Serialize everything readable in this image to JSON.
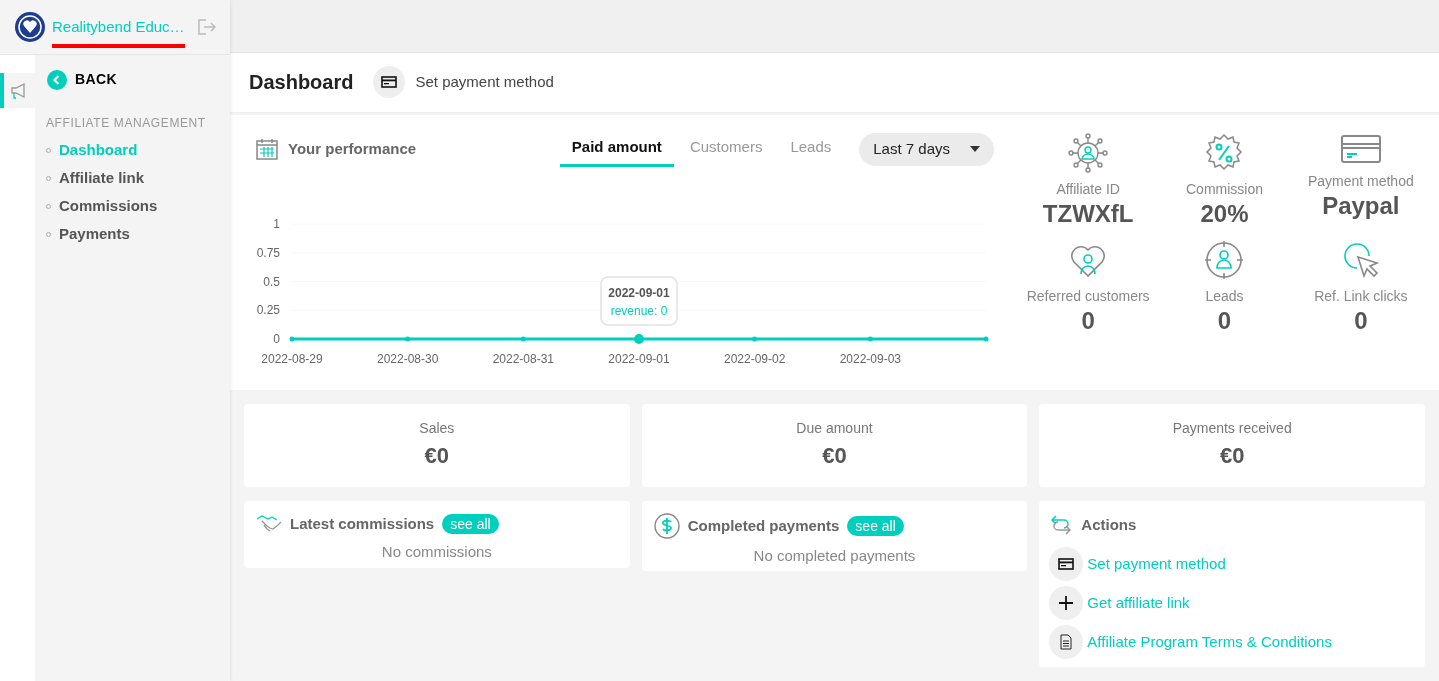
{
  "brand": {
    "name": "Realitybend Educ…"
  },
  "rail_items": [
    {
      "selected": true
    }
  ],
  "sidebar": {
    "back": "BACK",
    "section": "AFFILIATE MANAGEMENT",
    "items": [
      {
        "label": "Dashboard",
        "selected": true
      },
      {
        "label": "Affiliate link",
        "selected": false
      },
      {
        "label": "Commissions",
        "selected": false
      },
      {
        "label": "Payments",
        "selected": false
      }
    ]
  },
  "page": {
    "title": "Dashboard",
    "action": "Set payment method"
  },
  "performance": {
    "title": "Your performance",
    "tabs": [
      {
        "label": "Paid amount",
        "selected": true
      },
      {
        "label": "Customers",
        "selected": false
      },
      {
        "label": "Leads",
        "selected": false
      }
    ],
    "range": "Last 7 days",
    "chart_data": {
      "type": "line",
      "categories": [
        "2022-08-29",
        "2022-08-30",
        "2022-08-31",
        "2022-09-01",
        "2022-09-02",
        "2022-09-03",
        null
      ],
      "yticks": [
        0,
        0.25,
        0.5,
        0.75,
        1
      ],
      "ylim": [
        0,
        1
      ],
      "series": [
        {
          "color": "#00cfbd",
          "values": [
            0,
            0,
            0,
            0,
            0,
            0,
            0
          ]
        }
      ],
      "annotations": [
        "2022-09-01",
        "revenue: 0"
      ]
    }
  },
  "stats": [
    {
      "kind": "network",
      "label": "Affiliate ID",
      "value": "TZWXfL"
    },
    {
      "kind": "percent",
      "label": "Commission",
      "value": "20%"
    },
    {
      "kind": "card",
      "label": "Payment method",
      "value": "Paypal"
    },
    {
      "kind": "heart",
      "label": "Referred customers",
      "value": "0"
    },
    {
      "kind": "target",
      "label": "Leads",
      "value": "0"
    },
    {
      "kind": "cursor",
      "label": "Ref. Link clicks",
      "value": "0"
    }
  ],
  "summary": [
    {
      "label": "Sales",
      "value": "€0"
    },
    {
      "label": "Due amount",
      "value": "€0"
    },
    {
      "label": "Payments received",
      "value": "€0"
    }
  ],
  "panels": [
    {
      "kind": "handshake",
      "title": "Latest commissions",
      "link": "see all",
      "empty": "No commissions"
    },
    {
      "kind": "dollar",
      "title": "Completed payments",
      "link": "see all",
      "empty": "No completed payments"
    }
  ],
  "actions": {
    "title": "Actions",
    "items": [
      {
        "kind": "card",
        "label": "Set payment method"
      },
      {
        "kind": "plus",
        "label": "Get affiliate link"
      },
      {
        "kind": "doc",
        "label": "Affiliate Program Terms & Conditions"
      }
    ]
  }
}
